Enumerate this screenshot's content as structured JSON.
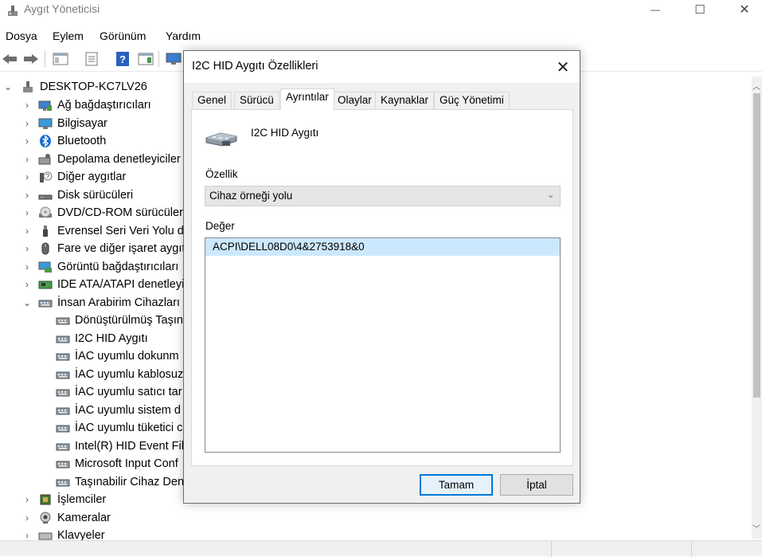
{
  "window": {
    "title": "Aygıt Yöneticisi",
    "controls": {
      "minimize": "—",
      "maximize": "☐",
      "close": "✕"
    }
  },
  "menu": [
    "Dosya",
    "Eylem",
    "Görünüm",
    "Yardım"
  ],
  "toolbar": {
    "icons": [
      "back-arrow-icon",
      "forward-arrow-icon",
      "show-hide-tree-icon",
      "properties-icon",
      "help-icon",
      "action-pane-icon",
      "monitor-icon"
    ]
  },
  "tree": {
    "root": "DESKTOP-KC7LV26",
    "items": [
      {
        "label": "Ağ bağdaştırıcıları",
        "icon": "network-adapter-icon",
        "expanded": false
      },
      {
        "label": "Bilgisayar",
        "icon": "computer-icon",
        "expanded": false
      },
      {
        "label": "Bluetooth",
        "icon": "bluetooth-icon",
        "expanded": false
      },
      {
        "label": "Depolama denetleyiciler",
        "icon": "storage-controller-icon",
        "expanded": false
      },
      {
        "label": "Diğer aygıtlar",
        "icon": "unknown-device-icon",
        "expanded": false
      },
      {
        "label": "Disk sürücüleri",
        "icon": "disk-drive-icon",
        "expanded": false
      },
      {
        "label": "DVD/CD-ROM sürücüler",
        "icon": "dvd-drive-icon",
        "expanded": false
      },
      {
        "label": "Evrensel Seri Veri Yolu de",
        "icon": "usb-icon",
        "expanded": false
      },
      {
        "label": "Fare ve diğer işaret aygıt",
        "icon": "mouse-icon",
        "expanded": false
      },
      {
        "label": "Görüntü bağdaştırıcıları",
        "icon": "display-adapter-icon",
        "expanded": false
      },
      {
        "label": "IDE ATA/ATAPI denetleyic",
        "icon": "ide-controller-icon",
        "expanded": false
      },
      {
        "label": "İnsan Arabirim Cihazları",
        "icon": "hid-icon",
        "expanded": true
      }
    ],
    "children": [
      "Dönüştürülmüş Taşın",
      "I2C HID Aygıtı",
      "İAC uyumlu dokunm",
      "İAC uyumlu kablosuz",
      "İAC uyumlu satıcı tar",
      "İAC uyumlu sistem d",
      "İAC uyumlu tüketici c",
      "Intel(R) HID Event Fil",
      "Microsoft Input Conf",
      "Taşınabilir Cihaz Den"
    ],
    "after": [
      {
        "label": "İşlemciler",
        "icon": "processor-icon"
      },
      {
        "label": "Kameralar",
        "icon": "camera-icon"
      },
      {
        "label": "Klavyeler",
        "icon": "keyboard-icon"
      }
    ]
  },
  "dialog": {
    "title": "I2C HID Aygıtı Özellikleri",
    "close": "✕",
    "tabs": [
      "Genel",
      "Sürücü",
      "Ayrıntılar",
      "Olaylar",
      "Kaynaklar",
      "Güç Yönetimi"
    ],
    "active_tab": "Ayrıntılar",
    "device_name": "I2C HID Aygıtı",
    "property_label": "Özellik",
    "property_value": "Cihaz örneği yolu",
    "value_label": "Değer",
    "values": [
      "ACPI\\DELL08D0\\4&2753918&0"
    ],
    "ok": "Tamam",
    "cancel": "İptal"
  },
  "colors": {
    "selection": "#cce8ff",
    "accent": "#0078d7",
    "dialog_bg": "#f0f0f0"
  }
}
